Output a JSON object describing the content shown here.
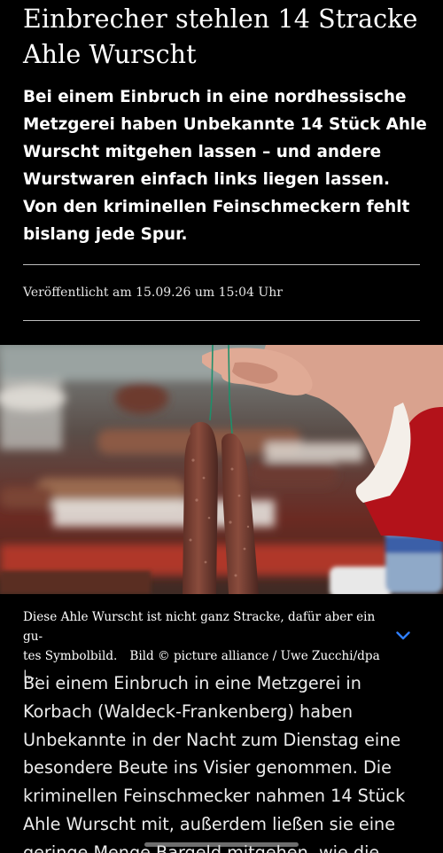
{
  "article": {
    "headline": "Einbrecher stehlen 14 Stracke Ahle Wurscht",
    "teaser": "Bei einem Einbruch in eine nordhessische Metzgerei haben Unbekannte 14 Stück Ahle Wurscht mitgehen lassen – und andere Wurstwaren einfach links liegen lassen. Von den kriminellen Feinschmeckern fehlt bislang jede Spur.",
    "published": "Veröffentlicht am 15.09.26 um 15:04 Uhr",
    "image": {
      "caption_line1": "Diese Ahle Wurscht ist nicht ganz Stracke, dafür aber ein gu-",
      "caption_line2": "tes Symbolbild.",
      "credit": "Bild © picture alliance / Uwe Zucchi/dpa |...",
      "expand_icon": "chevron-down-icon"
    },
    "body": "Bei einem Einbruch in eine Metzgerei in Korbach (Waldeck-Frankenberg) haben Unbekannte in der Nacht zum Dienstag eine besondere Beute ins Visier genommen. Die kriminellen Feinschmecker nahmen 14 Stück Ahle Wurscht mit, außerdem ließen sie eine geringe Menge Bargeld mitgehen, wie die"
  },
  "colors": {
    "background": "#000000",
    "text": "#ffffff",
    "accent": "#2f7fff",
    "rule": "#bdbdbd"
  }
}
